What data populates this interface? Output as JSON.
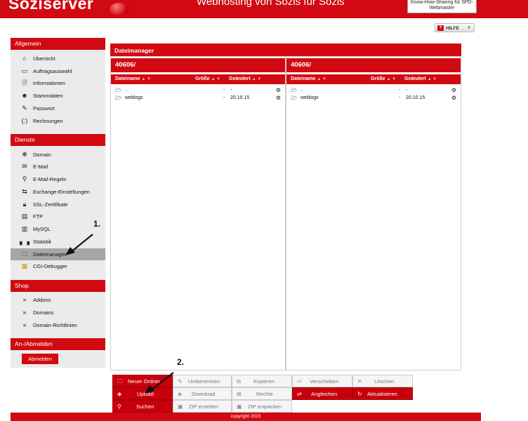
{
  "header": {
    "logo": "Soziserver",
    "slogan": "Webhosting von Sozis für Sozis",
    "knowhow": "Know-How-Sharing für SPD-Webmaster"
  },
  "help": {
    "label": "HILFE"
  },
  "sidebar": {
    "sections": [
      {
        "title": "Allgemein",
        "items": [
          "Übersicht",
          "Auftragsauswahl",
          "Informationen",
          "Stammdaten",
          "Passwort",
          "Rechnungen"
        ]
      },
      {
        "title": "Dienste",
        "items": [
          "Domain",
          "E-Mail",
          "E-Mail-Regeln",
          "Exchange-Einstellungen",
          "SSL-Zertifikate",
          "FTP",
          "MySQL",
          "Statistik",
          "Dateimanager",
          "CGI-Debugger"
        ]
      },
      {
        "title": "Shop",
        "items": [
          "Addons",
          "Domains",
          "Domain-Richtlinien"
        ]
      },
      {
        "title": "An-/Abmelden",
        "items": []
      }
    ],
    "logout_label": "Abmelden",
    "active_item": "Dateimanager"
  },
  "filemanager": {
    "title": "Dateimanager",
    "panes": [
      {
        "path": "40606/",
        "columns": {
          "name": "Dateiname",
          "size": "Größe",
          "changed": "Geändert"
        },
        "rows": [
          {
            "name": "..",
            "size": "-",
            "changed": "-"
          },
          {
            "name": "weblogs",
            "size": "-",
            "changed": "20.10.15"
          }
        ]
      },
      {
        "path": "40606/",
        "columns": {
          "name": "Dateiname",
          "size": "Größe",
          "changed": "Geändert"
        },
        "rows": [
          {
            "name": "..",
            "size": "-",
            "changed": "-"
          },
          {
            "name": "weblogs",
            "size": "-",
            "changed": "20.10.15"
          }
        ]
      }
    ]
  },
  "toolbar": {
    "new_folder": "Neuer Ordner",
    "upload": "Upload",
    "search": "Suchen",
    "rename": "Umbenennen",
    "download": "Download",
    "zip_create": "ZIP erstellen",
    "copy": "Kopieren",
    "rights": "Rechte",
    "zip_extract": "ZIP entpacken",
    "move": "Verschieben",
    "sync": "Angleichen",
    "delete": "Löschen",
    "refresh": "Aktualisieren"
  },
  "footer": {
    "copyright": "copyright 2015"
  },
  "annotations": {
    "step1": "1.",
    "step2": "2."
  }
}
